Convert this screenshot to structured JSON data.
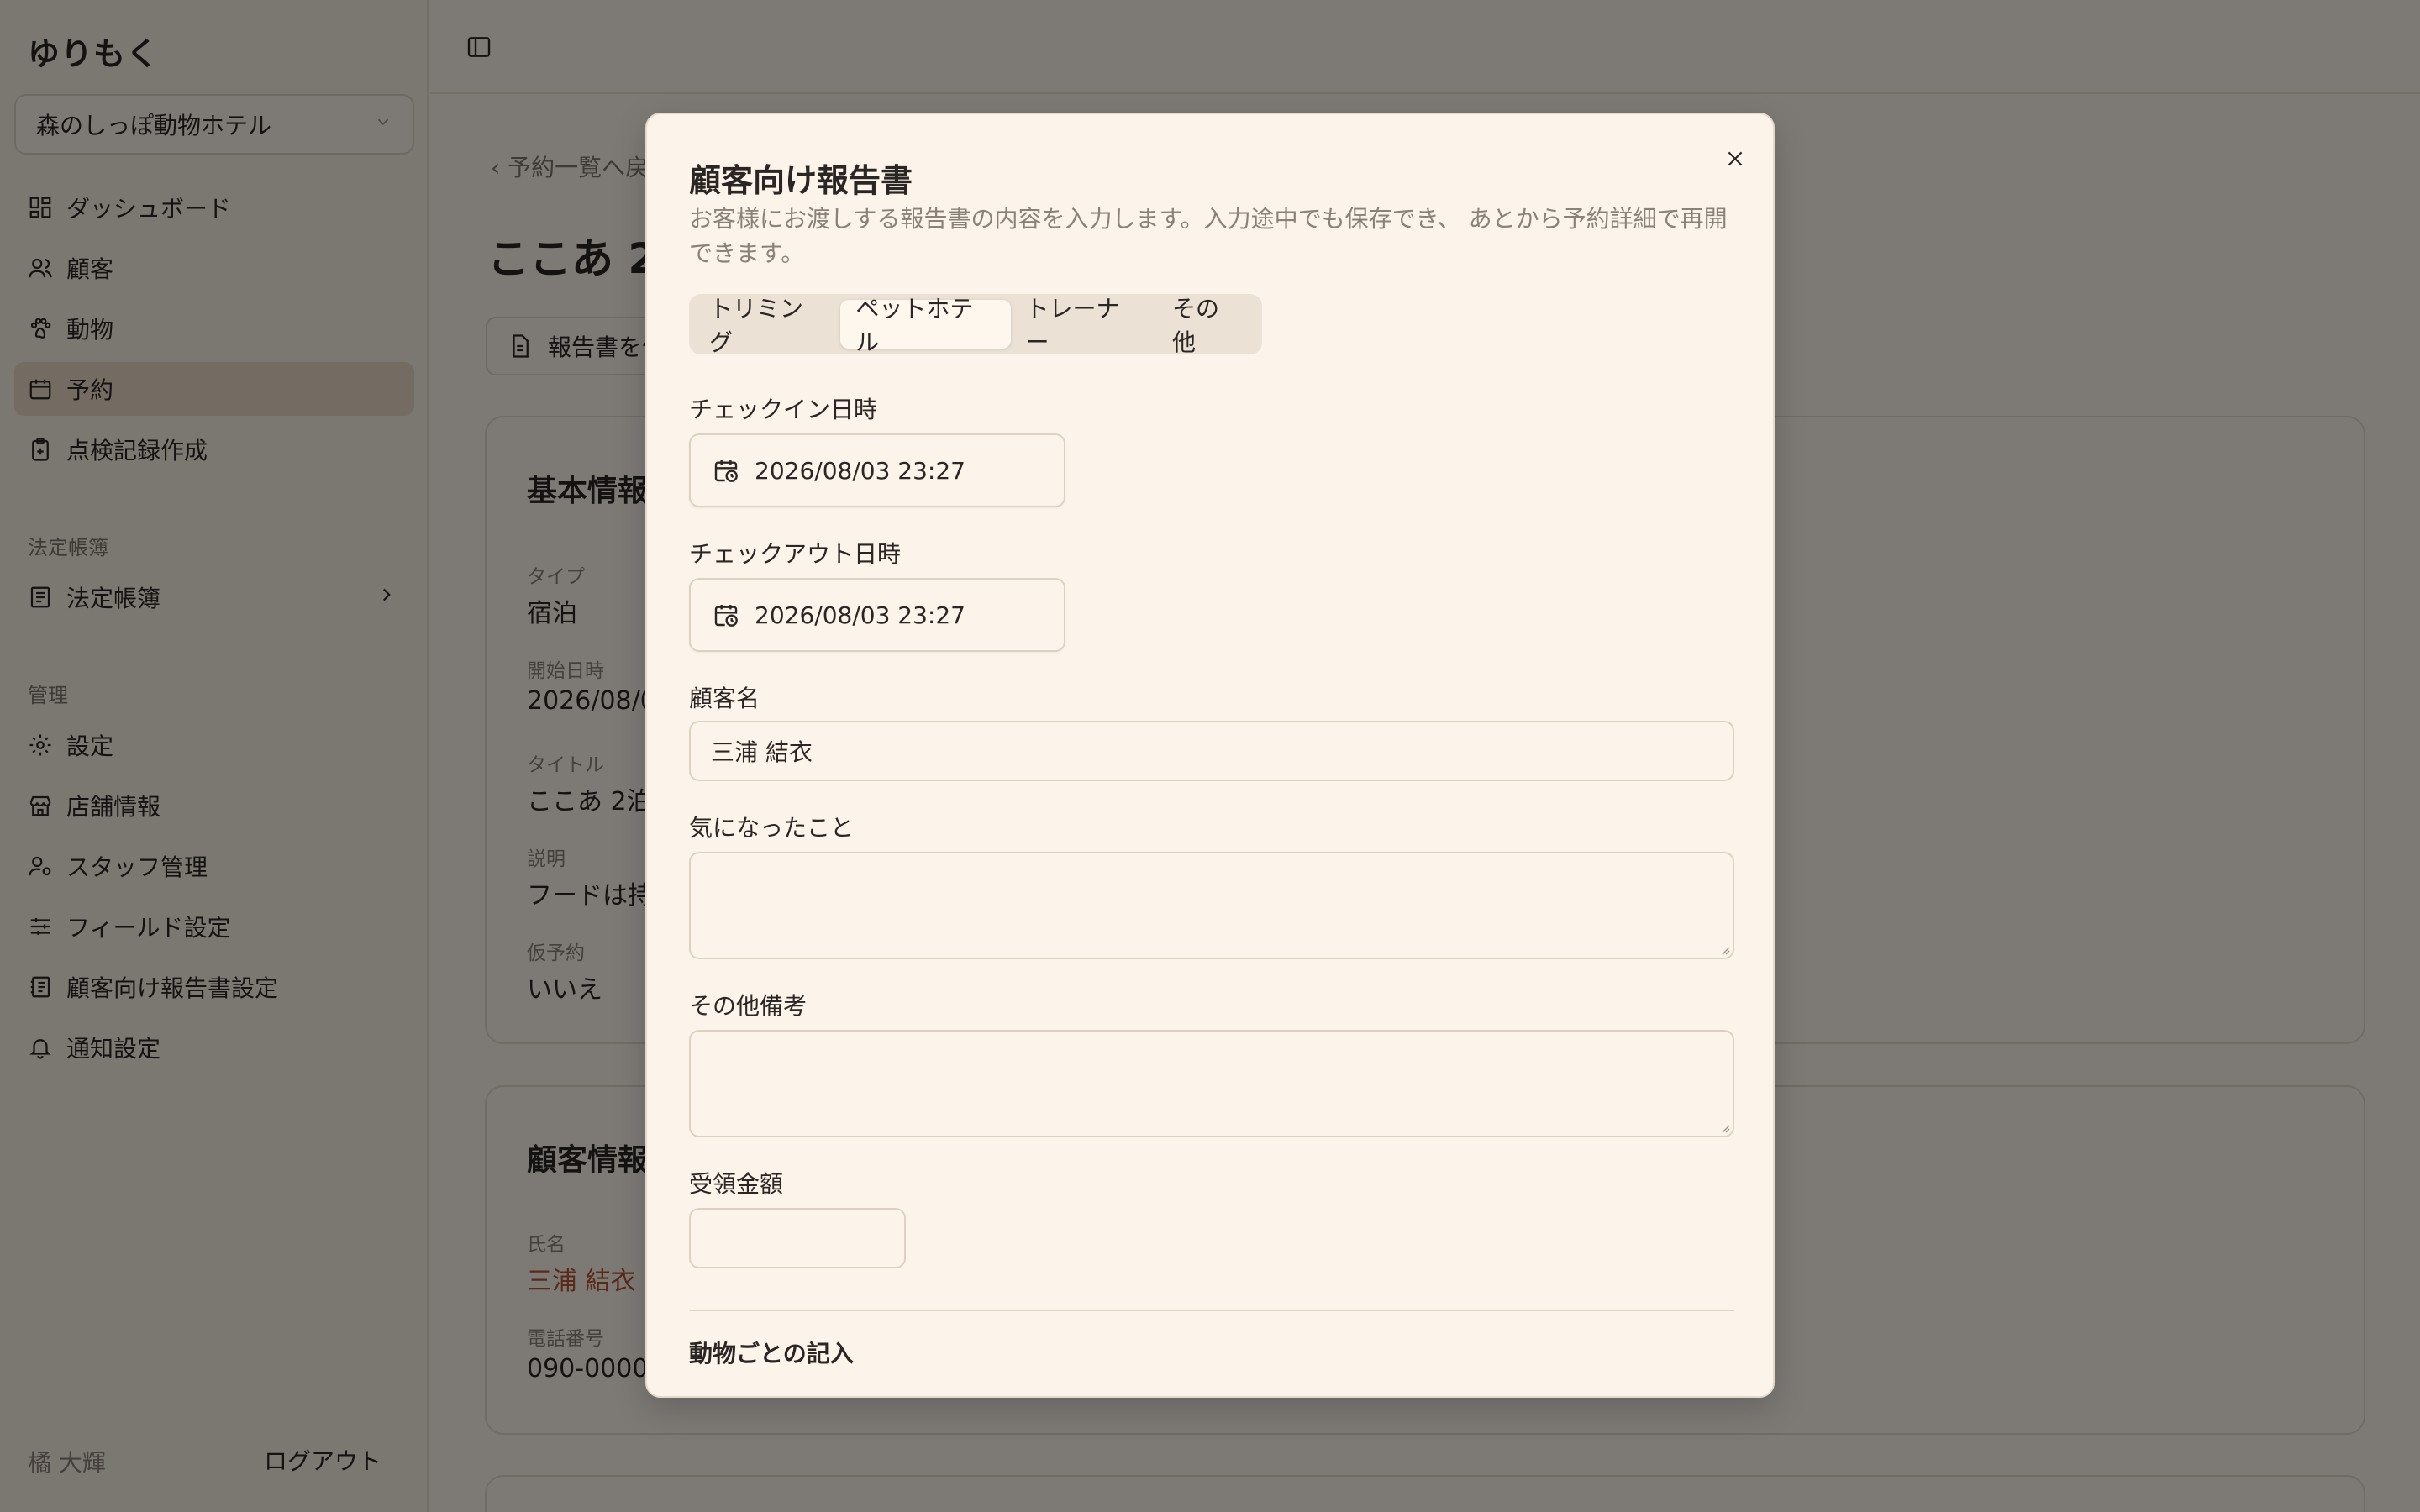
{
  "app": {
    "brand": "ゆりもく",
    "store": "森のしっぽ動物ホテル"
  },
  "sidebar": {
    "main_items": [
      {
        "label": "ダッシュボード",
        "icon": "dashboard-icon"
      },
      {
        "label": "顧客",
        "icon": "users-icon"
      },
      {
        "label": "動物",
        "icon": "paw-icon"
      },
      {
        "label": "予約",
        "icon": "calendar-icon",
        "active": true
      },
      {
        "label": "点検記録作成",
        "icon": "clipboard-icon"
      }
    ],
    "ledger_section": "法定帳簿",
    "ledger_item": {
      "label": "法定帳簿",
      "icon": "book-icon"
    },
    "admin_section": "管理",
    "admin_items": [
      {
        "label": "設定",
        "icon": "gear-icon"
      },
      {
        "label": "店舗情報",
        "icon": "store-icon"
      },
      {
        "label": "スタッフ管理",
        "icon": "user-gear-icon"
      },
      {
        "label": "フィールド設定",
        "icon": "sliders-icon"
      },
      {
        "label": "顧客向け報告書設定",
        "icon": "report-icon"
      },
      {
        "label": "通知設定",
        "icon": "bell-icon"
      }
    ],
    "user_name": "橘 大輝",
    "logout_label": "ログアウト"
  },
  "background": {
    "back_link": "予約一覧へ戻",
    "page_title": "ここあ 2泊",
    "report_button": "報告書を作",
    "basic_card": {
      "title": "基本情報",
      "fields": [
        {
          "label": "タイプ",
          "value": "宿泊"
        },
        {
          "label": "開始日時",
          "value": "2026/08/0"
        },
        {
          "label": "タイトル",
          "value": "ここあ 2泊"
        },
        {
          "label": "説明",
          "value": "フードは持"
        },
        {
          "label": "仮予約",
          "value": "いいえ"
        }
      ]
    },
    "customer_card": {
      "title": "顧客情報",
      "fields": [
        {
          "label": "氏名",
          "value": "三浦 結衣"
        },
        {
          "label": "電話番号",
          "value": "090-0000"
        }
      ]
    }
  },
  "dialog": {
    "title": "顧客向け報告書",
    "description": "お客様にお渡しする報告書の内容を入力します。入力途中でも保存でき、 あとから予約詳細で再開できます。",
    "tabs": [
      {
        "label": "トリミング",
        "active": false
      },
      {
        "label": "ペットホテル",
        "active": true
      },
      {
        "label": "トレーナー",
        "active": false
      },
      {
        "label": "その他",
        "active": false
      }
    ],
    "checkin_label": "チェックイン日時",
    "checkin_value": "2026/08/03 23:27",
    "checkout_label": "チェックアウト日時",
    "checkout_value": "2026/08/03 23:27",
    "customer_label": "顧客名",
    "customer_value": "三浦 結衣",
    "concerns_label": "気になったこと",
    "notes_label": "その他備考",
    "amount_label": "受領金額",
    "animal_section": "動物ごとの記入"
  }
}
